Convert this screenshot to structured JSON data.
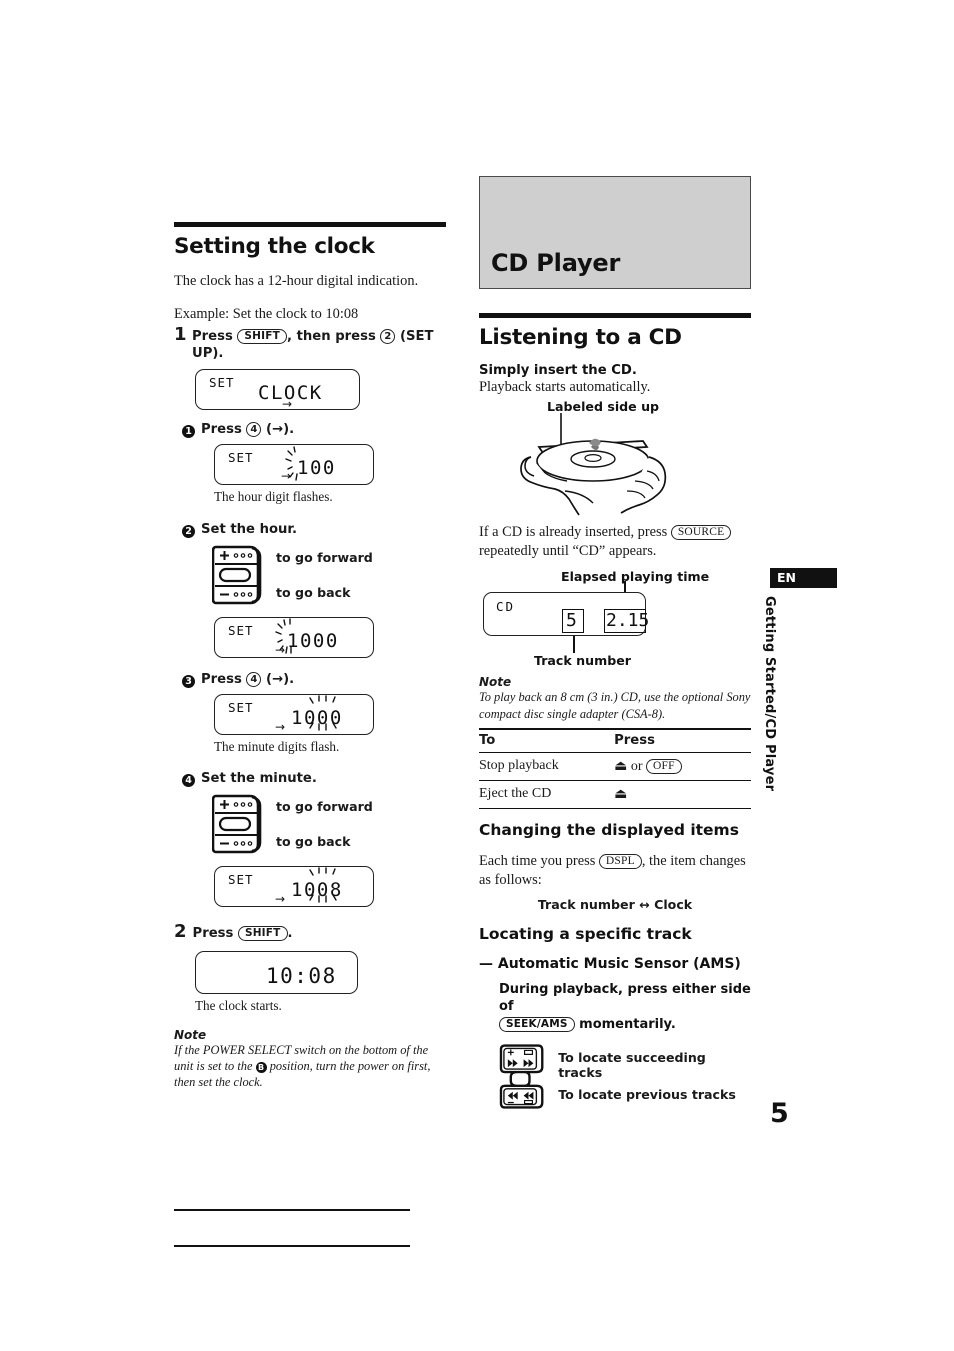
{
  "left_column": {
    "section_title": "Setting the clock",
    "intro": "The clock has a 12-hour digital indication.",
    "example_line": "Example: Set the clock to 10:08",
    "step1": {
      "number": "1",
      "text_a": "Press",
      "key1": "SHIFT",
      "text_b": ", then press",
      "key2": "2",
      "text_c": "(SET UP)."
    },
    "lcd_clock": {
      "set": "SET",
      "value": "CLOCK",
      "arrow": "→"
    },
    "substep1": {
      "bullet": "1",
      "text_a": "Press",
      "key": "4",
      "text_b": "(→).",
      "lcd": {
        "set": "SET",
        "flash_digits": "1",
        "static_digits": "00",
        "arrow": "→"
      },
      "caption": "The hour digit flashes."
    },
    "substep2": {
      "bullet": "2",
      "text": "Set the hour.",
      "forward_label": "to go forward",
      "back_label": "to go back",
      "lcd": {
        "set": "SET",
        "flash_digits": "1",
        "static_digits": "000",
        "arrow": "→"
      }
    },
    "substep3": {
      "bullet": "3",
      "text_a": "Press",
      "key": "4",
      "text_b": "(→).",
      "lcd": {
        "set": "SET",
        "static_prefix": "10",
        "flash_digits": "00",
        "arrow": "→"
      },
      "caption": "The minute digits flash."
    },
    "substep4": {
      "bullet": "4",
      "text": "Set the minute.",
      "forward_label": "to go forward",
      "back_label": "to go back",
      "lcd": {
        "set": "SET",
        "static_prefix": "10",
        "flash_digits": "08",
        "arrow": "→"
      }
    },
    "step2": {
      "number": "2",
      "text_a": "Press",
      "key": "SHIFT",
      "text_b": "."
    },
    "lcd_final": {
      "value": "10:08"
    },
    "final_caption": "The clock starts.",
    "note": {
      "heading": "Note",
      "text_a": "If the POWER SELECT switch on the bottom of the unit is set to the",
      "badge": "B",
      "text_b": "position, turn the power on first, then set the clock."
    }
  },
  "right_column": {
    "banner_title": "CD Player",
    "section_title": "Listening to a CD",
    "subhead_insert": "Simply insert the CD.",
    "insert_body": "Playback starts automatically.",
    "illustration_label": "Labeled side up",
    "source_line": {
      "text_a": "If a CD is already inserted, press",
      "key": "SOURCE",
      "text_b": "repeatedly until “CD” appears."
    },
    "display_diagram": {
      "elapsed_label": "Elapsed playing time",
      "track_label": "Track number",
      "lcd_mode": "CD",
      "track_value": "5",
      "time_value": "2.15"
    },
    "note": {
      "heading": "Note",
      "text": "To play back an 8 cm (3 in.) CD, use the optional Sony compact disc single adapter (CSA-8)."
    },
    "table": {
      "headers": [
        "To",
        "Press"
      ],
      "rows": [
        {
          "to": "Stop playback",
          "press_glyph": "⏏",
          "press_conj": "or",
          "press_key": "OFF"
        },
        {
          "to": "Eject the CD",
          "press_glyph": "⏏",
          "press_conj": "",
          "press_key": ""
        }
      ]
    },
    "displayed_items": {
      "heading": "Changing the displayed items",
      "text_a": "Each time you press",
      "key": "DSPL",
      "text_b": ", the item changes as follows:",
      "flow": "Track number ↔ Clock"
    },
    "ams": {
      "heading": "Locating a specific track",
      "subheading": "— Automatic Music Sensor (AMS)",
      "instruction_a": "During playback, press either side of",
      "key": "SEEK/AMS",
      "instruction_b": "momentarily.",
      "succeeding_label": "To locate succeeding tracks",
      "previous_label": "To locate previous tracks"
    }
  },
  "side_tab": {
    "language": "EN",
    "chapter": "Getting Started/CD Player"
  },
  "page_number": "5"
}
